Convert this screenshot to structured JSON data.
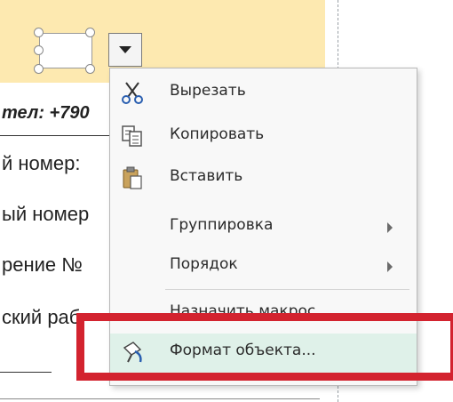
{
  "document": {
    "line1": "тел: +790",
    "line2": "й номер:",
    "line3": "ый номер",
    "line4": "рение №",
    "line5": "ский раб"
  },
  "context_menu": {
    "items": [
      {
        "label": "Вырезать",
        "icon": "scissors-icon",
        "submenu": false
      },
      {
        "label": "Копировать",
        "icon": "copy-icon",
        "submenu": false
      },
      {
        "label": "Вставить",
        "icon": "paste-icon",
        "submenu": false
      },
      {
        "label": "Группировка",
        "icon": "",
        "submenu": true
      },
      {
        "label": "Порядок",
        "icon": "",
        "submenu": true
      },
      {
        "label": "Назначить макрос...",
        "icon": "",
        "submenu": false
      },
      {
        "label": "Формат объекта...",
        "icon": "format-object-icon",
        "submenu": false,
        "highlighted": true
      }
    ]
  },
  "colors": {
    "document_fill": "#fde9b0",
    "menu_hover": "#dff1e9",
    "callout_red": "#d3232f"
  }
}
